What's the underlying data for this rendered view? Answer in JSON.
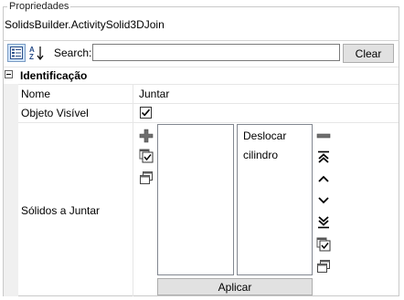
{
  "panel": {
    "title": "Propriedades",
    "object_name": "SolidsBuilder.ActivitySolid3DJoin"
  },
  "toolbar": {
    "categorized_icon": "categorized-view-icon",
    "alphabetical_icon": "alphabetical-sort-icon",
    "search_label": "Search:",
    "search_value": "",
    "clear_label": "Clear"
  },
  "category": {
    "label": "Identificação",
    "expanded": true
  },
  "properties": [
    {
      "name": "Nome",
      "value": "Juntar"
    },
    {
      "name": "Objeto Visível",
      "checked": true
    },
    {
      "name": "Sólidos a Juntar"
    }
  ],
  "join_editor": {
    "available_items": [],
    "selected_items": [
      "Deslocar",
      "cilindro"
    ],
    "left_tools": [
      "add-icon",
      "select-all-icon",
      "copy-icon"
    ],
    "right_tools": [
      "remove-icon",
      "move-top-icon",
      "move-up-icon",
      "move-down-icon",
      "move-bottom-icon",
      "select-all-icon",
      "copy-icon"
    ],
    "apply_label": "Aplicar"
  },
  "colors": {
    "border": "#c9c9c9",
    "gutter": "#f0f0f0",
    "button_face": "#e1e1e1",
    "pressed_button": "#cfe3fb"
  }
}
